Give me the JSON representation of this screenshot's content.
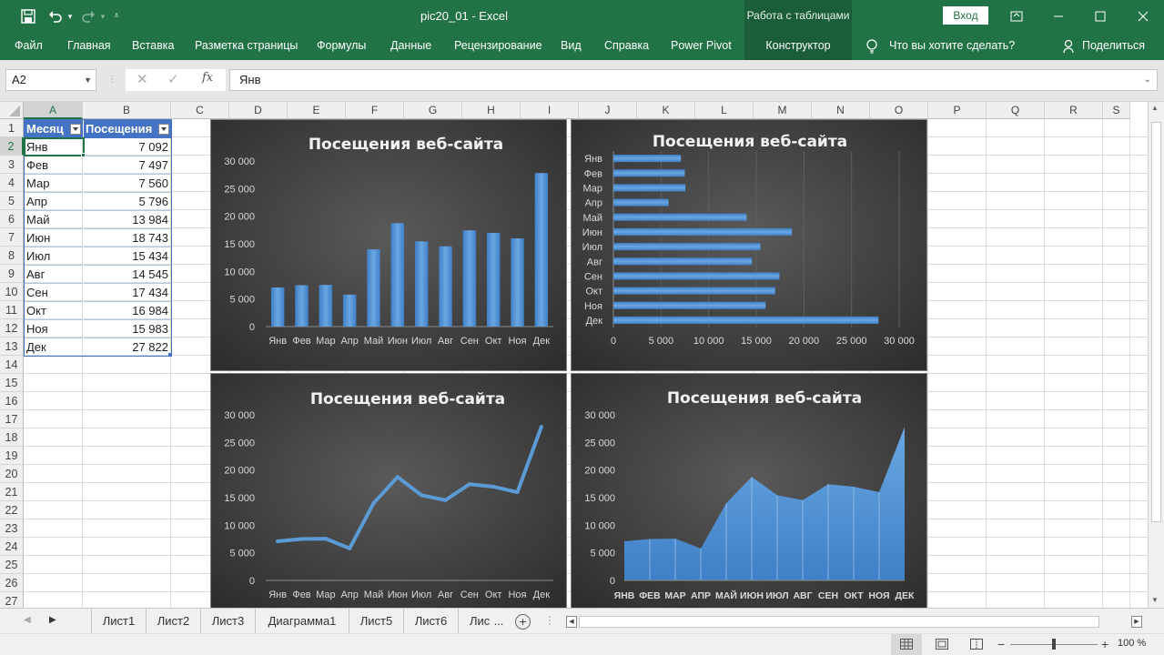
{
  "window": {
    "title": "pic20_01  -  Excel",
    "contextual_group": "Работа с таблицами",
    "signin": "Вход",
    "controls": [
      "restore-ribbon-icon",
      "minimize-icon",
      "maximize-icon",
      "close-icon"
    ]
  },
  "ribbon": {
    "tabs": [
      "Файл",
      "Главная",
      "Вставка",
      "Разметка страницы",
      "Формулы",
      "Данные",
      "Рецензирование",
      "Вид",
      "Справка",
      "Power Pivot",
      "Конструктор"
    ],
    "tell_me": "Что вы хотите сделать?",
    "share": "Поделиться"
  },
  "formula_bar": {
    "name_box": "A2",
    "fx": "fx",
    "value": "Янв"
  },
  "grid": {
    "columns": [
      "A",
      "B",
      "C",
      "D",
      "E",
      "F",
      "G",
      "H",
      "I",
      "J",
      "K",
      "L",
      "M",
      "N",
      "O",
      "P",
      "Q",
      "R",
      "S"
    ],
    "rows": [
      "1",
      "2",
      "3",
      "4",
      "5",
      "6",
      "7",
      "8",
      "9",
      "10",
      "11",
      "12",
      "13",
      "14",
      "15",
      "16",
      "17",
      "18",
      "19",
      "20",
      "21",
      "22",
      "23",
      "24",
      "25",
      "26",
      "27"
    ],
    "header": [
      "Месяц",
      "Посещения"
    ],
    "table": [
      {
        "month": "Янв",
        "visits": "7 092"
      },
      {
        "month": "Фев",
        "visits": "7 497"
      },
      {
        "month": "Мар",
        "visits": "7 560"
      },
      {
        "month": "Апр",
        "visits": "5 796"
      },
      {
        "month": "Май",
        "visits": "13 984"
      },
      {
        "month": "Июн",
        "visits": "18 743"
      },
      {
        "month": "Июл",
        "visits": "15 434"
      },
      {
        "month": "Авг",
        "visits": "14 545"
      },
      {
        "month": "Сен",
        "visits": "17 434"
      },
      {
        "month": "Окт",
        "visits": "16 984"
      },
      {
        "month": "Ноя",
        "visits": "15 983"
      },
      {
        "month": "Дек",
        "visits": "27 822"
      }
    ]
  },
  "chart_data": [
    {
      "type": "bar",
      "title": "Посещения веб-сайта",
      "categories": [
        "Янв",
        "Фев",
        "Мар",
        "Апр",
        "Май",
        "Июн",
        "Июл",
        "Авг",
        "Сен",
        "Окт",
        "Ноя",
        "Дек"
      ],
      "values": [
        7092,
        7497,
        7560,
        5796,
        13984,
        18743,
        15434,
        14545,
        17434,
        16984,
        15983,
        27822
      ],
      "ylim": [
        0,
        30000
      ],
      "ticks": [
        "0",
        "5 000",
        "10 000",
        "15 000",
        "20 000",
        "25 000",
        "30 000"
      ],
      "grid": false,
      "orientation": "vertical"
    },
    {
      "type": "bar",
      "title": "Посещения веб-сайта",
      "categories": [
        "Янв",
        "Фев",
        "Мар",
        "Апр",
        "Май",
        "Июн",
        "Июл",
        "Авг",
        "Сен",
        "Окт",
        "Ноя",
        "Дек"
      ],
      "values": [
        7092,
        7497,
        7560,
        5796,
        13984,
        18743,
        15434,
        14545,
        17434,
        16984,
        15983,
        27822
      ],
      "xlim": [
        0,
        30000
      ],
      "ticks": [
        "0",
        "5 000",
        "10 000",
        "15 000",
        "20 000",
        "25 000",
        "30 000"
      ],
      "grid": true,
      "orientation": "horizontal"
    },
    {
      "type": "line",
      "title": "Посещения веб-сайта",
      "categories": [
        "Янв",
        "Фев",
        "Мар",
        "Апр",
        "Май",
        "Июн",
        "Июл",
        "Авг",
        "Сен",
        "Окт",
        "Ноя",
        "Дек"
      ],
      "values": [
        7092,
        7497,
        7560,
        5796,
        13984,
        18743,
        15434,
        14545,
        17434,
        16984,
        15983,
        27822
      ],
      "ylim": [
        0,
        30000
      ],
      "ticks": [
        "0",
        "5 000",
        "10 000",
        "15 000",
        "20 000",
        "25 000",
        "30 000"
      ],
      "grid": false
    },
    {
      "type": "area",
      "title": "Посещения веб-сайта",
      "categories": [
        "ЯНВ",
        "ФЕВ",
        "МАР",
        "АПР",
        "МАЙ",
        "ИЮН",
        "ИЮЛ",
        "АВГ",
        "СЕН",
        "ОКТ",
        "НОЯ",
        "ДЕК"
      ],
      "values": [
        7092,
        7497,
        7560,
        5796,
        13984,
        18743,
        15434,
        14545,
        17434,
        16984,
        15983,
        27822
      ],
      "ylim": [
        0,
        30000
      ],
      "ticks": [
        "0",
        "5 000",
        "10 000",
        "15 000",
        "20 000",
        "25 000",
        "30 000"
      ],
      "grid": false
    }
  ],
  "sheets": {
    "tabs": [
      "Лист1",
      "Лист2",
      "Лист3",
      "Диаграмма1",
      "Лист5",
      "Лист6",
      "Лис"
    ],
    "more": "..."
  },
  "status": {
    "zoom": "100 %",
    "zoom_value": 100
  },
  "colors": {
    "excel_green": "#217346",
    "chart_bg": "#3a3a3a",
    "series": "#5b9bd5"
  }
}
